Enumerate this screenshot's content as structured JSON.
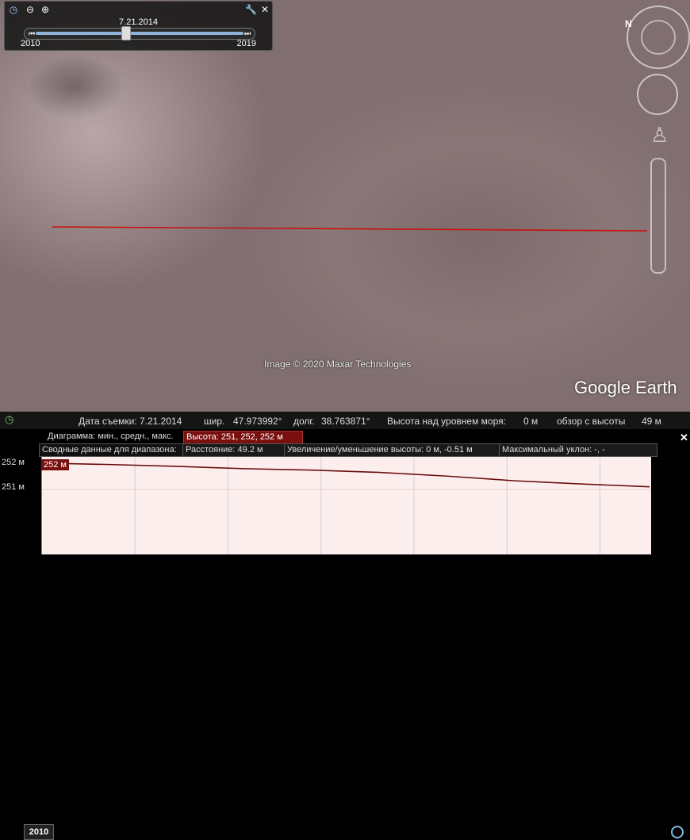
{
  "timeline": {
    "date": "7.21.2014",
    "start_year": "2010",
    "end_year": "2019",
    "position_fraction": 0.43
  },
  "map": {
    "credit": "Image © 2020 Maxar Technologies",
    "brand": "Google Earth",
    "line_color": "#cc1010"
  },
  "status_bar": {
    "year_button": "2010",
    "date_label": "Дата съемки: 7.21.2014",
    "lat_label": "шир.",
    "lat_value": "47.973992°",
    "lon_label": "долг.",
    "lon_value": "38.763871°",
    "elev_label": "Высота над уровнем моря:",
    "elev_value": "0 м",
    "eye_label": "обзор с высоты",
    "eye_value": "49 м"
  },
  "profile": {
    "diagram_label": "Диаграмма: мин., средн., макс.",
    "height_box": "Высота: 251, 252, 252 м",
    "summary_label": "Сводные данные для диапазона:",
    "distance_box": "Расстояние: 49.2 м",
    "gain_box": "Увеличение/уменьшение высоты: 0 м, -0.51 м",
    "slope_box": "Максимальный уклон: -, -",
    "y_top": "252 м",
    "y_mid": "251 м",
    "badge": "252 м",
    "line_color": "#6b0c0c"
  },
  "chart_data": {
    "type": "line",
    "ylabel": "",
    "xlabel": "",
    "yticks": [
      "252 м",
      "251 м"
    ],
    "ylim": [
      250,
      252.1
    ],
    "series": [
      {
        "values": [
          252.0,
          251.97,
          251.93,
          251.88,
          251.85,
          251.8,
          251.72,
          251.62,
          251.55,
          251.49
        ]
      }
    ]
  }
}
